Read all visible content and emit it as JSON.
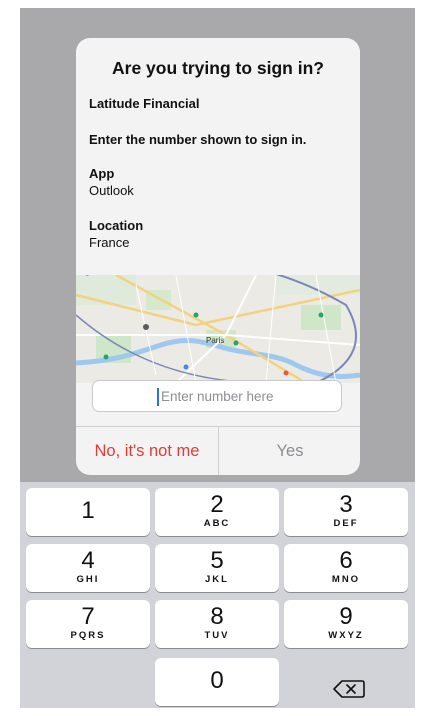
{
  "dialog": {
    "title": "Are you trying to sign in?",
    "org": "Latitude Financial",
    "instruction": "Enter the number shown to sign in.",
    "app_label": "App",
    "app_value": "Outlook",
    "location_label": "Location",
    "location_value": "France",
    "map_city": "Paris",
    "input_placeholder": "Enter number here",
    "deny_label": "No, it's not me",
    "approve_label": "Yes"
  },
  "keypad": {
    "keys": [
      {
        "num": "1",
        "letters": ""
      },
      {
        "num": "2",
        "letters": "ABC"
      },
      {
        "num": "3",
        "letters": "DEF"
      },
      {
        "num": "4",
        "letters": "GHI"
      },
      {
        "num": "5",
        "letters": "JKL"
      },
      {
        "num": "6",
        "letters": "MNO"
      },
      {
        "num": "7",
        "letters": "PQRS"
      },
      {
        "num": "8",
        "letters": "TUV"
      },
      {
        "num": "9",
        "letters": "WXYZ"
      },
      {
        "num": "0",
        "letters": ""
      }
    ],
    "delete_icon": "backspace-icon"
  },
  "colors": {
    "screen_bg": "#a9a9ab",
    "dialog_bg": "#f3f3f4",
    "deny": "#e53935",
    "approve": "#8d8d91",
    "caret": "#2f6fe8"
  }
}
